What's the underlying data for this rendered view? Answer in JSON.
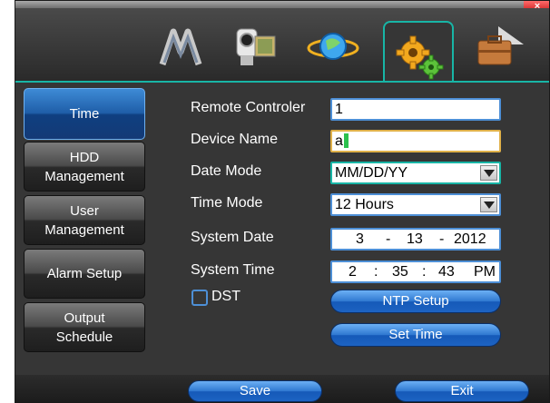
{
  "window": {
    "close_glyph": "×"
  },
  "toolbar": {
    "icons": [
      {
        "name": "video-tape-icon"
      },
      {
        "name": "camcorder-icon"
      },
      {
        "name": "network-globe-icon"
      },
      {
        "name": "settings-gears-icon"
      },
      {
        "name": "toolbox-icon"
      }
    ],
    "accent": "#18b5a6"
  },
  "sidebar": {
    "items": [
      {
        "label": "Time",
        "active": true
      },
      {
        "label_line1": "HDD",
        "label_line2": "Management"
      },
      {
        "label_line1": "User",
        "label_line2": "Management"
      },
      {
        "label": "Alarm Setup"
      },
      {
        "label_line1": "Output",
        "label_line2": "Schedule"
      }
    ]
  },
  "form": {
    "remote_controller": {
      "label": "Remote Controler",
      "value": "1"
    },
    "device_name": {
      "label": "Device Name",
      "value": "a"
    },
    "date_mode": {
      "label": "Date Mode",
      "value": "MM/DD/YY"
    },
    "time_mode": {
      "label": "Time Mode",
      "value": "12 Hours"
    },
    "system_date": {
      "label": "System Date",
      "month": "3",
      "sep1": "-",
      "day": "13",
      "sep2": "-",
      "year": "2012"
    },
    "system_time": {
      "label": "System Time",
      "hour": "2",
      "sep1": ":",
      "minute": "35",
      "sep2": ":",
      "second": "43",
      "ampm": "PM"
    },
    "dst": {
      "label": "DST",
      "checked": false
    },
    "ntp_setup": "NTP Setup",
    "set_time": "Set Time"
  },
  "footer": {
    "save": "Save",
    "exit": "Exit"
  }
}
